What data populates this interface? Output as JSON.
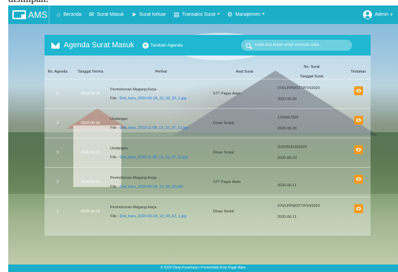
{
  "caption": "disimpan.",
  "navbar": {
    "brand": "AMS",
    "items": [
      {
        "label": "Beranda",
        "icon": "home-icon"
      },
      {
        "label": "Surat Masuk",
        "icon": "envelope-icon"
      },
      {
        "label": "Surat Keluar",
        "icon": "paper-plane-icon"
      },
      {
        "label": "Transaksi Surat",
        "icon": "document-icon"
      },
      {
        "label": "Manajemen",
        "icon": "gear-icon"
      }
    ],
    "user": "Admin"
  },
  "panel": {
    "title": "Agenda Surat Masuk",
    "add_label": "Tambah Agenda",
    "search_placeholder": "Ketik dan tekan enter mencari data..."
  },
  "table": {
    "headers": {
      "no": "No. Agenda",
      "tanggal": "Tanggal Terima",
      "perihal": "Perihal",
      "asal": "Asal Surat",
      "no_surat": "No. Surat",
      "tanggal_surat": "Tanggal Surat",
      "tindakan": "Tindakan"
    },
    "rows": [
      {
        "no": "5",
        "tanggal": "2020-06-30",
        "perihal": "Permohonan Magang Kerja",
        "file_prefix": "File :",
        "file": "Dok_baru_2020-06-18_10_09_02_1.jpg",
        "asal": "STT Pagar Alam",
        "no_surat": "076/LPPM/STTP/VI/2020",
        "tanggal_surat": "2020-06-30"
      },
      {
        "no": "4",
        "tanggal": "2020-06-26",
        "perihal": "Undangan",
        "file_prefix": "File :",
        "file": "Dok_baru_2019-11-08_13_10_37_12.jpg",
        "asal": "Dinas Sosial",
        "no_surat": "1234567890",
        "tanggal_surat": "2020-06-26"
      },
      {
        "no": "3",
        "tanggal": "2020-06-23",
        "perihal": "Undangan",
        "file_prefix": "File :",
        "file": "Dok_baru_2019-11-08_13_10_37_11.jpg",
        "asal": "Dinas Sosial",
        "no_surat": "20202020202020",
        "tanggal_surat": "2020-06-23"
      },
      {
        "no": "2",
        "tanggal": "2020-06-18",
        "perihal": "Permohonan Magang Kerja",
        "file_prefix": "File :",
        "file": "Dok_baru_2020-06-18_10_09_02.pdf",
        "asal": "STT Pagar Alam",
        "no_surat": "",
        "tanggal_surat": "2020-06-11"
      },
      {
        "no": "1",
        "tanggal": "2020-06-18",
        "perihal": "Permohonan Magang Kerja",
        "file_prefix": "File :",
        "file": "Dok_baru_2020-06-18_10_09_02_1.jpg",
        "asal": "Dinas Sosial",
        "no_surat": "076/LPPM/STTP/VI/2020",
        "tanggal_surat": "2020-06-11"
      }
    ]
  },
  "footer": "© 2020 Dinas Kesehatan | Pemerintah Kota Pagar Alam",
  "colors": {
    "primary": "#1caec8",
    "action": "#f29b1c",
    "link": "#1a7bd6"
  }
}
